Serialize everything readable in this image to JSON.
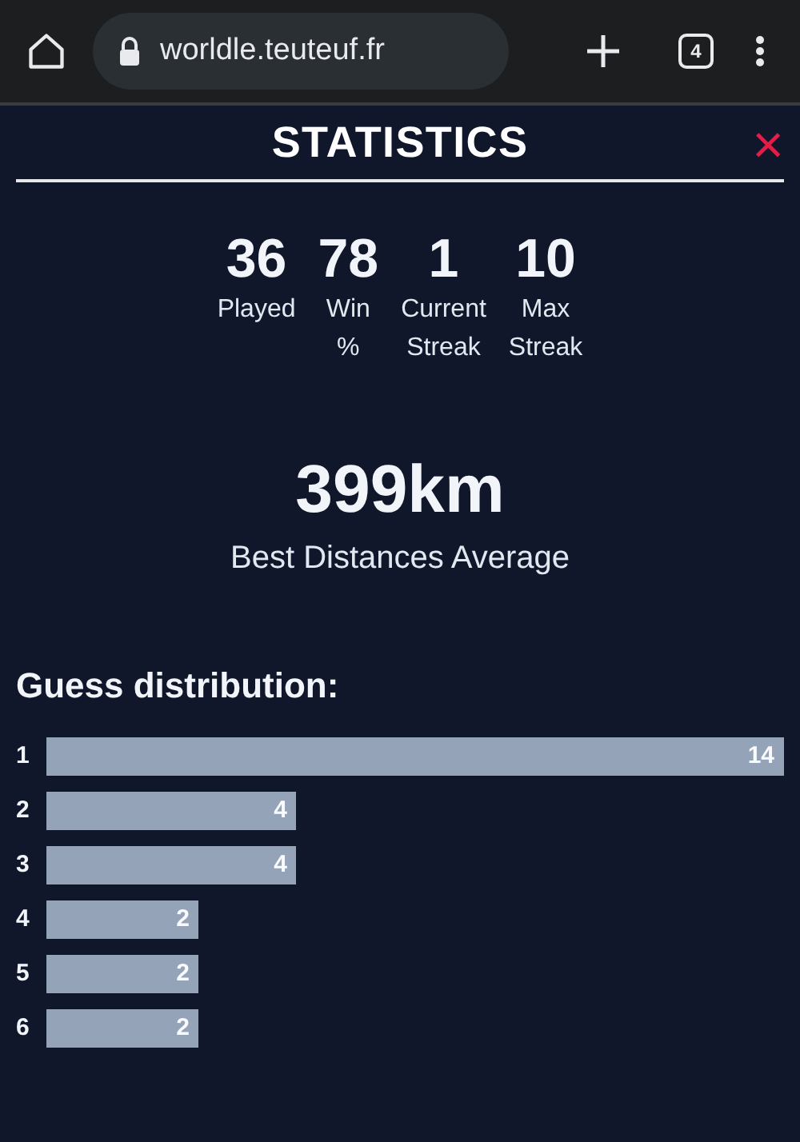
{
  "browser": {
    "url": "worldle.teuteuf.fr",
    "tab_count": "4"
  },
  "dialog": {
    "title": "STATISTICS",
    "close": "×"
  },
  "stats": [
    {
      "value": "36",
      "label": "Played"
    },
    {
      "value": "78",
      "label": "Win %"
    },
    {
      "value": "1",
      "label": "Current Streak"
    },
    {
      "value": "10",
      "label": "Max Streak"
    }
  ],
  "best_distance": {
    "value": "399km",
    "label": "Best Distances Average"
  },
  "guess_distribution": {
    "title": "Guess distribution:",
    "rows": [
      {
        "guess": "1",
        "count": "14"
      },
      {
        "guess": "2",
        "count": "4"
      },
      {
        "guess": "3",
        "count": "4"
      },
      {
        "guess": "4",
        "count": "2"
      },
      {
        "guess": "5",
        "count": "2"
      },
      {
        "guess": "6",
        "count": "2"
      }
    ]
  }
}
